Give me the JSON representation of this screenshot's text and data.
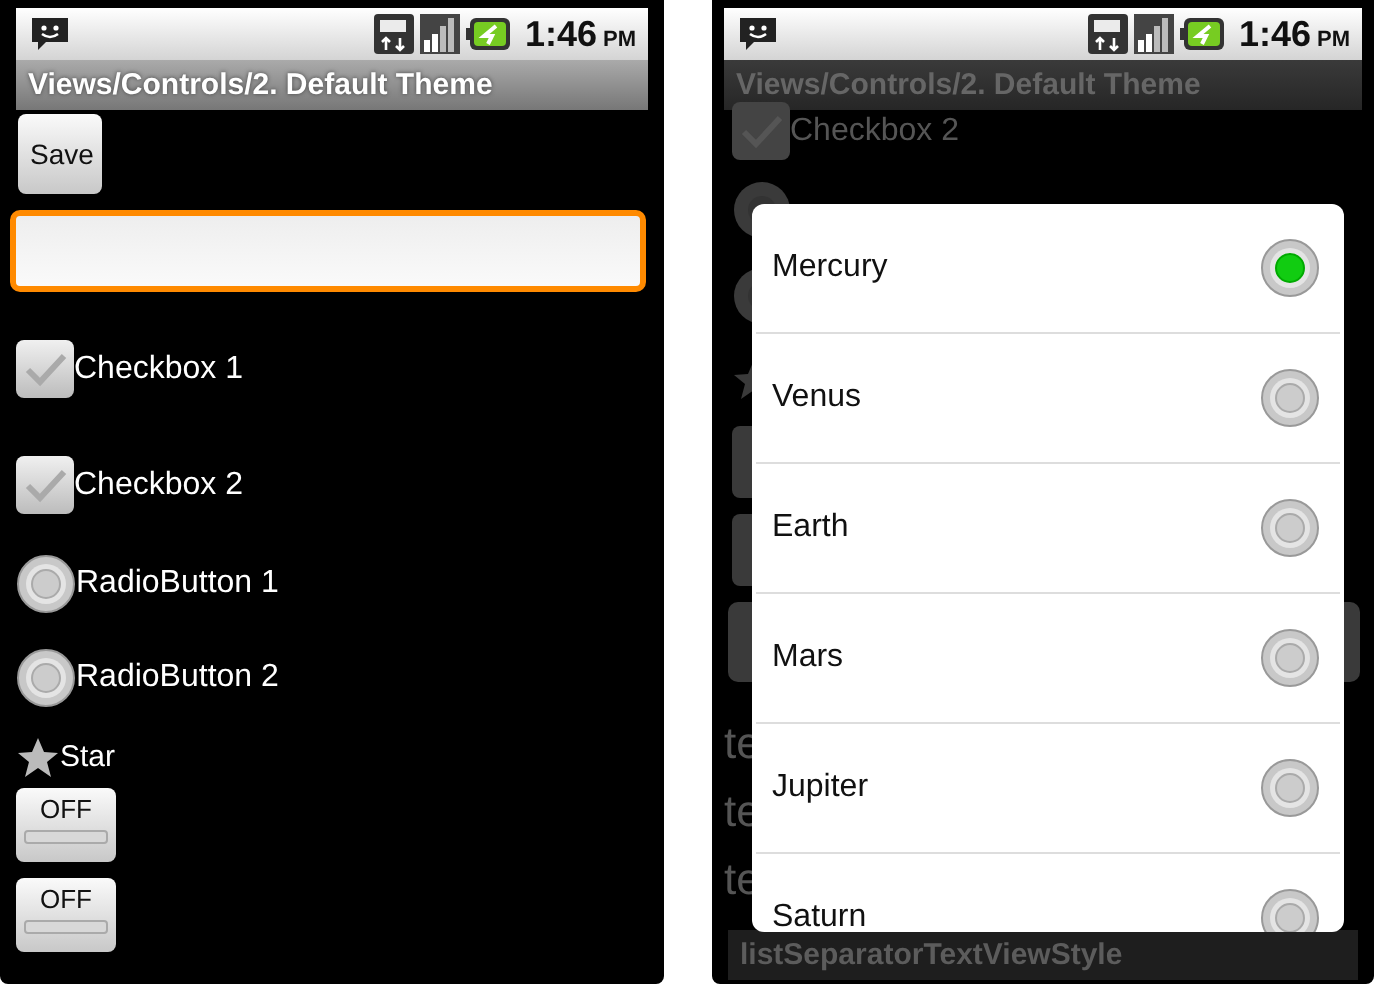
{
  "screens": [
    {
      "status_bar": {
        "time": "1:46",
        "ampm": "PM"
      },
      "title": "Views/Controls/2. Default Theme",
      "save_button": "Save",
      "text_field": {
        "focused": true
      },
      "checkboxes": [
        {
          "label": "Checkbox 1",
          "checked": false
        },
        {
          "label": "Checkbox 2",
          "checked": false
        }
      ],
      "radios": [
        {
          "label": "RadioButton 1",
          "selected": false
        },
        {
          "label": "RadioButton 2",
          "selected": false
        }
      ],
      "star": {
        "label": "Star",
        "on": false
      },
      "toggles": [
        {
          "label": "OFF",
          "on": false
        },
        {
          "label": "OFF",
          "on": false
        }
      ]
    },
    {
      "status_bar": {
        "time": "1:46",
        "ampm": "PM"
      },
      "title": "Views/Controls/2. Default Theme",
      "background": {
        "checkbox_label": "Checkbox 2",
        "checkbox_checked": false,
        "radios": [
          {
            "selected": false
          },
          {
            "selected": false
          }
        ],
        "text_lines": [
          "te",
          "te",
          "te"
        ],
        "separator": "listSeparatorTextViewStyle"
      },
      "dialog": {
        "items": [
          {
            "label": "Mercury",
            "selected": true
          },
          {
            "label": "Venus",
            "selected": false
          },
          {
            "label": "Earth",
            "selected": false
          },
          {
            "label": "Mars",
            "selected": false
          },
          {
            "label": "Jupiter",
            "selected": false
          },
          {
            "label": "Saturn",
            "selected": false
          }
        ]
      }
    }
  ]
}
